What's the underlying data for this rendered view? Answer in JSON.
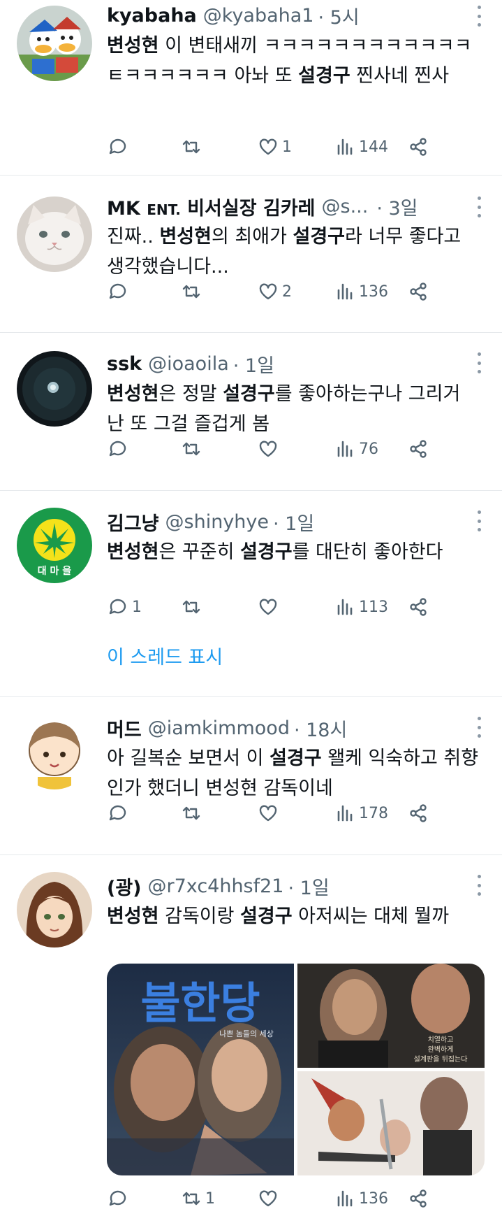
{
  "tweets": [
    {
      "name": "kyabaha",
      "handle": "@kyabaha1",
      "time": "· 5시",
      "segments": [
        {
          "t": "변성현",
          "b": true
        },
        {
          "t": " 이 변태새끼 ㅋㅋㅋㅋㅋㅋㅋㅋㅋㅋㅋㅋㅌㅋㅋㅋㅋㅋㅋ 아놔 또 ",
          "b": false
        },
        {
          "t": "설경구",
          "b": true
        },
        {
          "t": " 찐사네 찐사",
          "b": false
        }
      ],
      "reply": "",
      "retweet": "",
      "like": "1",
      "views": "144"
    },
    {
      "name": "MK",
      "name_small": "ENT.",
      "name_rest": "비서실장 김카레",
      "handle": "@s...",
      "time": "· 3일",
      "segments": [
        {
          "t": "진짜.. ",
          "b": false
        },
        {
          "t": "변성현",
          "b": true
        },
        {
          "t": "의 최애가 ",
          "b": false
        },
        {
          "t": "설경구",
          "b": true
        },
        {
          "t": "라 너무 좋다고 생각했습니다...",
          "b": false
        }
      ],
      "reply": "",
      "retweet": "",
      "like": "2",
      "views": "136"
    },
    {
      "name": "ssk",
      "handle": "@ioaoila",
      "time": "· 1일",
      "segments": [
        {
          "t": "변성현",
          "b": true
        },
        {
          "t": "은 정말 ",
          "b": false
        },
        {
          "t": "설경구",
          "b": true
        },
        {
          "t": "를 좋아하는구나 그리거 난 또 그걸 즐겁게 봄",
          "b": false
        }
      ],
      "reply": "",
      "retweet": "",
      "like": "",
      "views": "76"
    },
    {
      "name": "김그냥",
      "handle": "@shinyhye",
      "time": "· 1일",
      "segments": [
        {
          "t": "변성현",
          "b": true
        },
        {
          "t": "은 꾸준히 ",
          "b": false
        },
        {
          "t": "설경구",
          "b": true
        },
        {
          "t": "를 대단히 좋아한다",
          "b": false
        }
      ],
      "reply": "1",
      "retweet": "",
      "like": "",
      "views": "113",
      "avatar_text": "대 마 을",
      "thread_link": "이 스레드 표시"
    },
    {
      "name": "머드",
      "handle": "@iamkimmood",
      "time": "· 18시",
      "segments": [
        {
          "t": "아 길복순 보면서 이 ",
          "b": false
        },
        {
          "t": "설경구",
          "b": true
        },
        {
          "t": " 왤케 익숙하고 취향인가 했더니 변성현 감독이네",
          "b": false
        }
      ],
      "reply": "",
      "retweet": "",
      "like": "",
      "views": "178"
    },
    {
      "name": "(광)",
      "handle": "@r7xc4hhsf21",
      "time": "· 1일",
      "segments": [
        {
          "t": "변성현",
          "b": true
        },
        {
          "t": " 감독이랑 ",
          "b": false
        },
        {
          "t": "설경구",
          "b": true
        },
        {
          "t": " 아저씨는 대체 뭘까",
          "b": false
        }
      ],
      "reply": "",
      "retweet": "1",
      "like": "",
      "views": "136",
      "media": {
        "poster1_title": "불한당",
        "poster1_sub": "나쁜 놈들의 세상",
        "poster2_text": [
          "치열하고",
          "완벽하게",
          "설계판을 뒤집는다"
        ]
      }
    }
  ],
  "colors": {
    "accent": "#1d9bf0",
    "secondary": "#536471",
    "divider": "#e6e9ec"
  }
}
